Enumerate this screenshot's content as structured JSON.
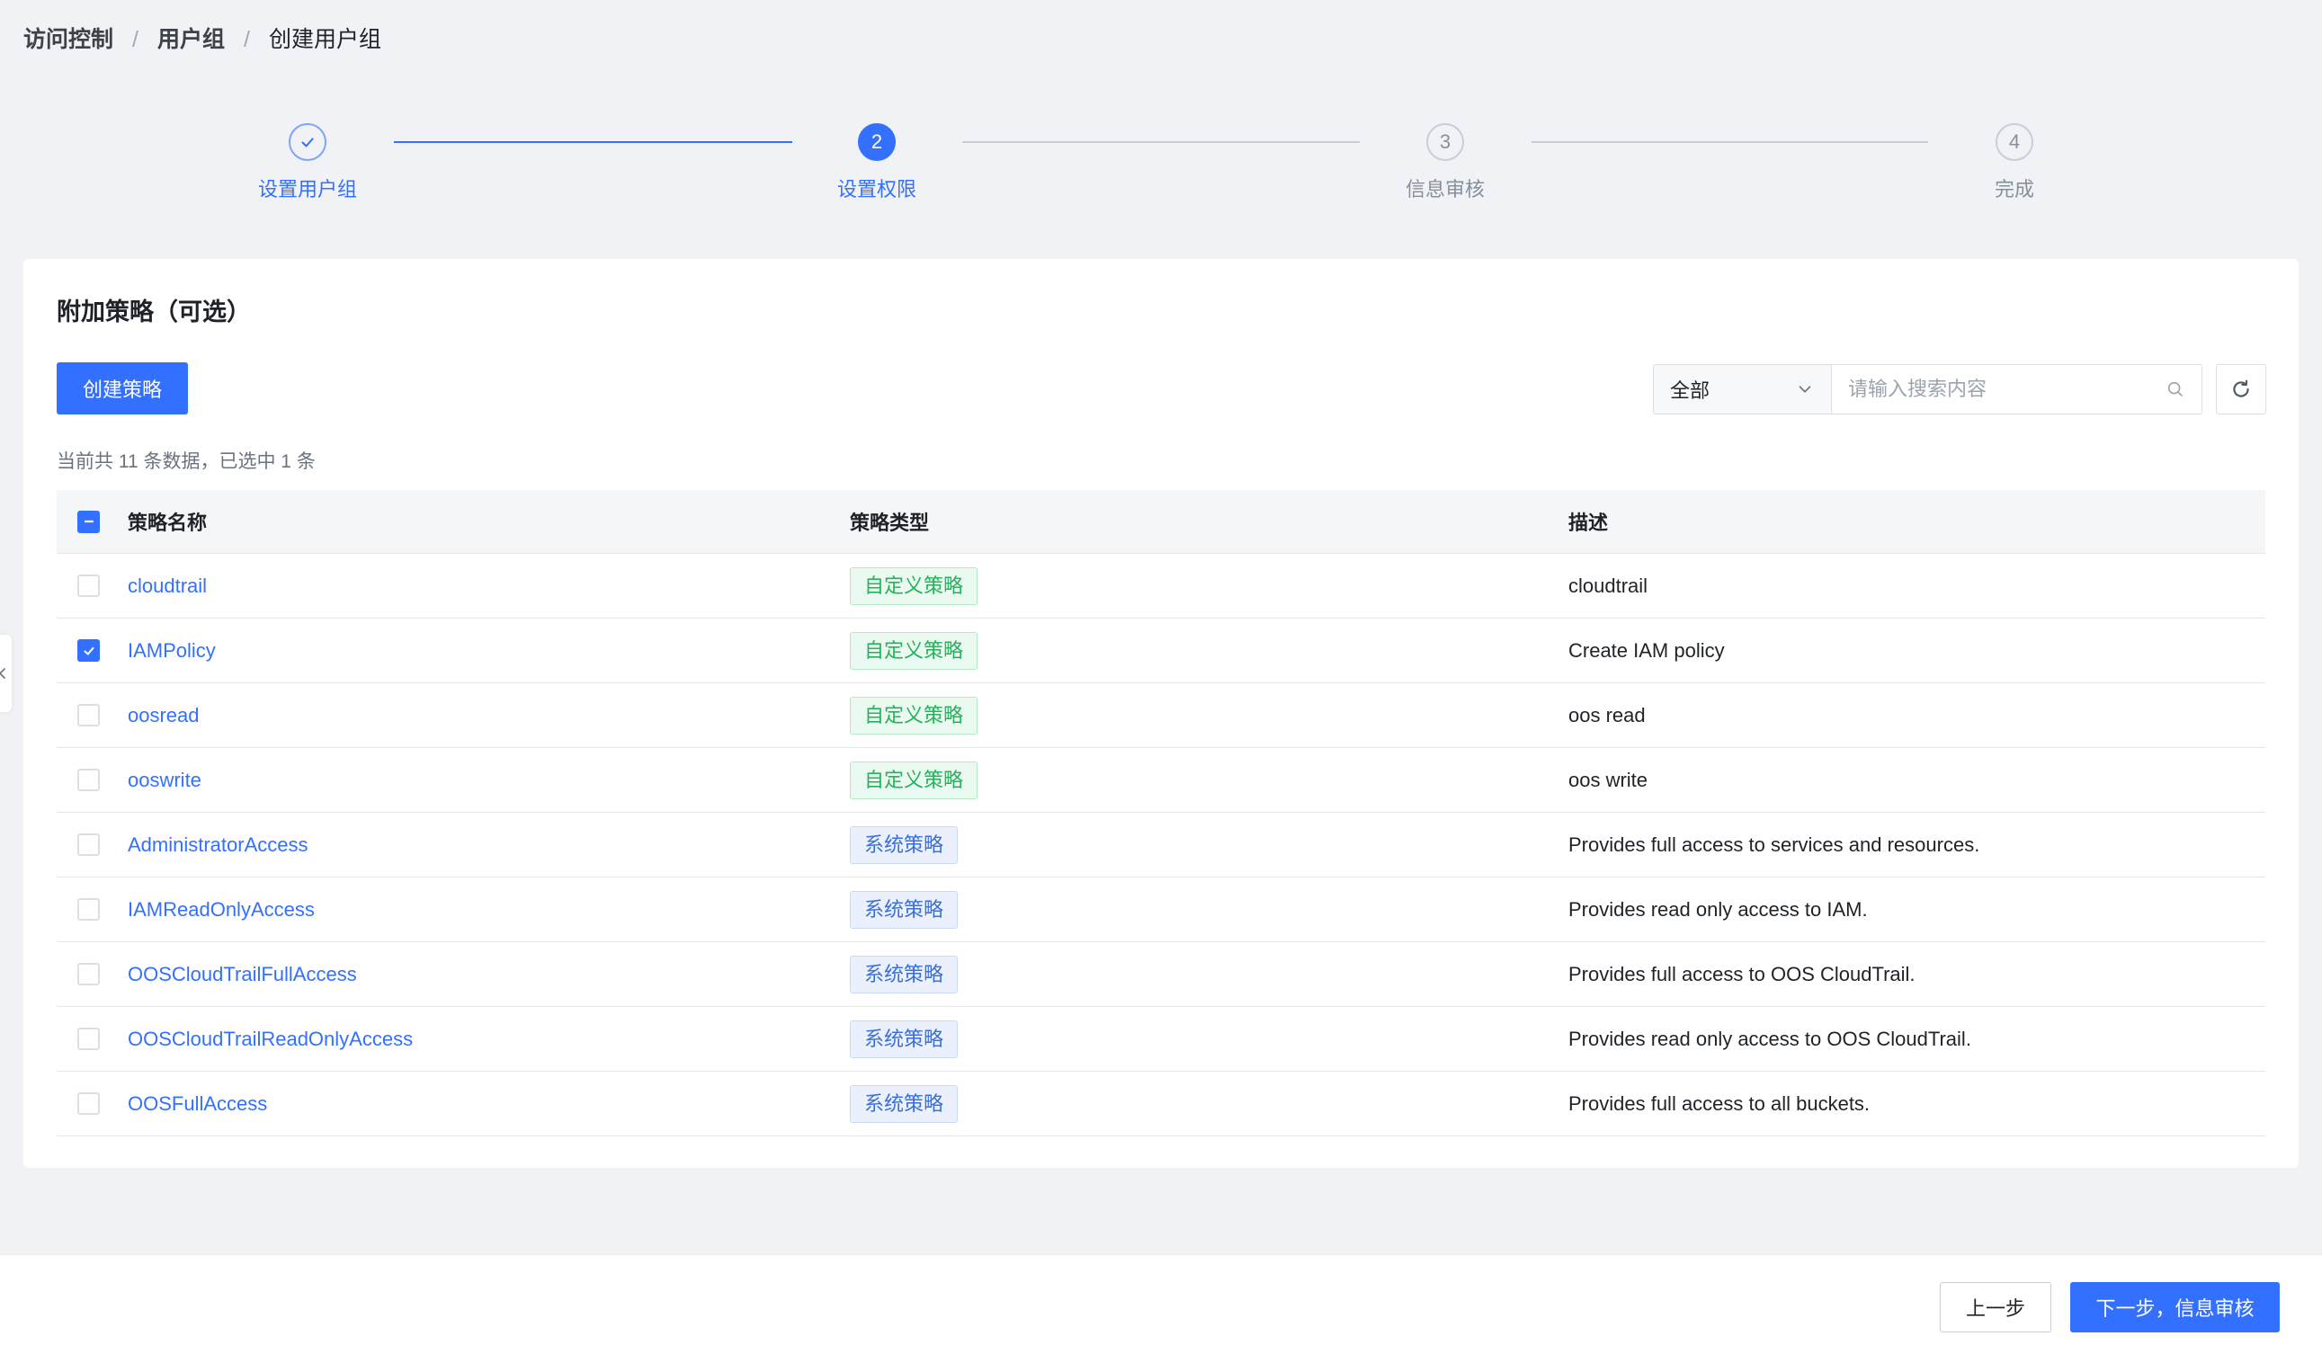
{
  "colors": {
    "primary": "#3370ff",
    "page_background": "#f1f2f5"
  },
  "breadcrumb": {
    "items": [
      "访问控制",
      "用户组",
      "创建用户组"
    ],
    "separator": "/"
  },
  "steps": [
    {
      "label": "设置用户组",
      "completed": true,
      "current": false,
      "icon": "check-icon"
    },
    {
      "number": "2",
      "label": "设置权限",
      "completed": false,
      "current": true
    },
    {
      "number": "3",
      "label": "信息审核",
      "completed": false,
      "current": false
    },
    {
      "number": "4",
      "label": "完成",
      "completed": false,
      "current": false
    }
  ],
  "card": {
    "title": "附加策略（可选）",
    "create_button": "创建策略",
    "filter_select": {
      "value": "全部",
      "icon": "chevron-down-icon"
    },
    "search": {
      "placeholder": "请输入搜索内容",
      "value": "",
      "icon": "search-icon"
    },
    "refresh_icon": "refresh-icon",
    "summary": "当前共 11 条数据，已选中 1 条"
  },
  "table": {
    "select_all_indeterminate": true,
    "columns": [
      "策略名称",
      "策略类型",
      "描述"
    ],
    "rows": [
      {
        "name": "cloudtrail",
        "type": "自定义策略",
        "description": "cloudtrail",
        "checked": false
      },
      {
        "name": "IAMPolicy",
        "type": "自定义策略",
        "description": "Create IAM policy",
        "checked": true
      },
      {
        "name": "oosread",
        "type": "自定义策略",
        "description": "oos read",
        "checked": false
      },
      {
        "name": "ooswrite",
        "type": "自定义策略",
        "description": "oos write",
        "checked": false
      },
      {
        "name": "AdministratorAccess",
        "type": "系统策略",
        "description": "Provides full access to services and resources.",
        "checked": false
      },
      {
        "name": "IAMReadOnlyAccess",
        "type": "系统策略",
        "description": "Provides read only access to IAM.",
        "checked": false
      },
      {
        "name": "OOSCloudTrailFullAccess",
        "type": "系统策略",
        "description": "Provides full access to OOS CloudTrail.",
        "checked": false
      },
      {
        "name": "OOSCloudTrailReadOnlyAccess",
        "type": "系统策略",
        "description": "Provides read only access to OOS CloudTrail.",
        "checked": false
      },
      {
        "name": "OOSFullAccess",
        "type": "系统策略",
        "description": "Provides full access to all buckets.",
        "checked": false
      }
    ]
  },
  "tag_styles": {
    "自定义策略": {
      "text": "#23b35a",
      "background": "#eafaf0",
      "border": "#b5e8c6"
    },
    "系统策略": {
      "text": "#3a6fd8",
      "background": "#eaf1fd",
      "border": "#c8d8f6"
    }
  },
  "footer": {
    "prev_button": "上一步",
    "next_button": "下一步，信息审核"
  },
  "sidebar_toggle": {
    "icon": "chevron-left-icon"
  }
}
